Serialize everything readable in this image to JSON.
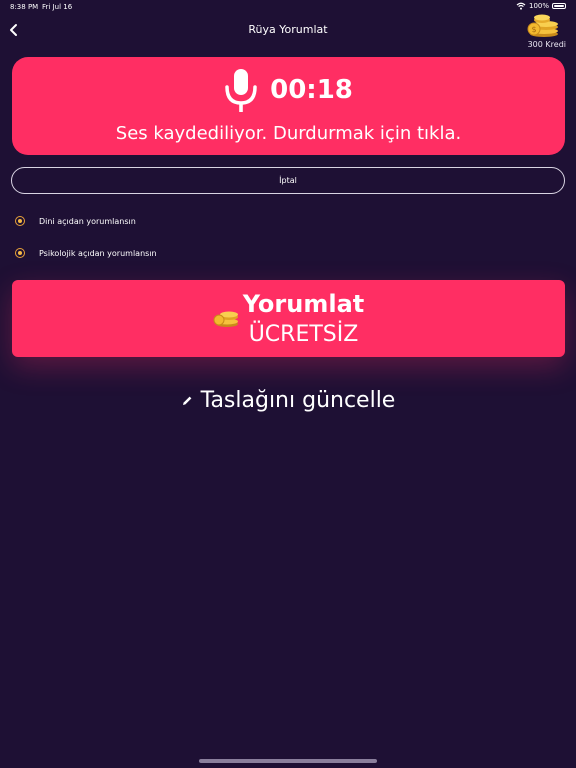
{
  "status": {
    "time": "8:38 PM",
    "date": "Fri Jul 16",
    "battery": "100%",
    "icons": [
      "wifi-icon",
      "battery-icon"
    ]
  },
  "nav": {
    "back_icon": "chevron-left-icon",
    "title": "Rüya Yorumlat",
    "credits_icon": "coins-icon",
    "credits_label": "300 Kredi"
  },
  "recording": {
    "icon": "microphone-icon",
    "timer": "00:18",
    "hint": "Ses kaydediliyor. Durdurmak için tıkla."
  },
  "cancel": {
    "label": "İptal"
  },
  "options": [
    {
      "label": "Dini açıdan yorumlansın",
      "selected": true
    },
    {
      "label": "Psikolojik açıdan yorumlansın",
      "selected": true
    }
  ],
  "interpret": {
    "icon": "coins-icon",
    "title": "Yorumlat",
    "subtitle": "ÜCRETSİZ"
  },
  "draft": {
    "icon": "pencil-icon",
    "label": "Taslağını güncelle"
  },
  "colors": {
    "background": "#1e1034",
    "accent": "#ff2e63",
    "radio": "#f5b945"
  }
}
